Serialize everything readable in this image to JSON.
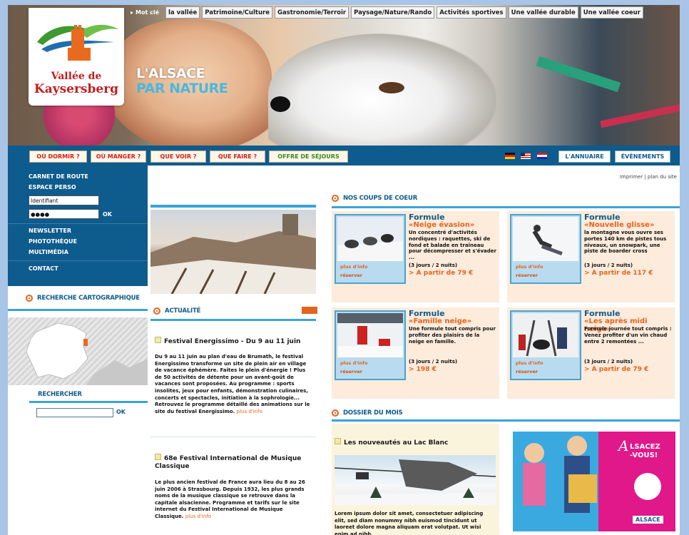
{
  "header": {
    "home_label": "Mot clé",
    "nav": [
      "la vallée",
      "Patrimoine/Culture",
      "Gastronomie/Terroir",
      "Paysage/Nature/Rando",
      "Activités sportives",
      "Une vallée durable",
      "Une vallée coeur"
    ],
    "logo_line1": "Vallée de",
    "logo_line2": "Kaysersberg",
    "tagline1": "L'ALSACE",
    "tagline2": "PAR NATURE"
  },
  "menu": {
    "items": [
      "OÙ DORMIR ?",
      "OÙ MANGER ?",
      "QUE VOIR ?",
      "QUE FAIRE ?",
      "OFFRE DE SÉJOURS"
    ],
    "right": [
      "L'ANNUAIRE",
      "ÉVÉNEMENTS"
    ]
  },
  "sidebar": {
    "links": [
      "CARNET DE ROUTE",
      "ESPACE PERSO"
    ],
    "login_value": "Identifiant",
    "password_value": "●●●●",
    "ok": "OK",
    "links2": [
      "NEWSLETTER",
      "PHOTOTHÈQUE",
      "MULTIMÉDIA"
    ],
    "contact": "CONTACT",
    "carto_title": "RECHERCHE CARTOGRAPHIQUE",
    "search_title": "RECHERCHER",
    "search_ok": "OK"
  },
  "middle": {
    "actualite": "ACTUALITÉ",
    "news": [
      {
        "title": "Festival Energissimo - Du 9 au 11 juin",
        "body": "Du 9 au 11 juin au plan d'eau de Brumath, le festival Energissimo transforme un site de plein air en village de vacance éphémère. Faites le plein d'énergie ! Plus de 50 activités de détente pour un avant-goût de vacances sont proposées. Au programme : sports insolites, jeux pour enfants, démonstration culinaires, concerts et spectacles, initiation à la sophrologie... Retrouvez le programme détaillé des animations sur le site du festival Energissimo.",
        "more": "plus d'info"
      },
      {
        "title": "68e Festival International de Musique Classique",
        "body": "Le plus ancien festival de France aura lieu du 8 au 26 juin 2006 à Strasbourg. Depuis 1932, les plus grands noms de la musique classique se retrouve dans la capitale alsacienne. Programme et tarifs sur le site internet du Festival International de Musique Classique.",
        "more": "plus d'info"
      }
    ]
  },
  "right": {
    "top_links": "Imprimer | plan du site",
    "coups_title": "NOS COUPS DE COEUR",
    "offers": [
      {
        "formule": "Formule",
        "name": "«Neige évasion»",
        "desc": "Un concentré d'activités nordiques : raquettes, ski de fond et balade en traîneau pour décompresser et s'évader ...",
        "duration": "(3 jours / 2 nuits)",
        "price": "> A partir de 79 €",
        "link1": "plus d'info",
        "link2": "réserver"
      },
      {
        "formule": "Formule",
        "name": "«Nouvelle glisse»",
        "desc": "la montagne vous ouvre ses portes 140 km de pistes tous niveaux, un snowpark, une piste de boarder cross",
        "duration": "(3 jours / 2 nuits)",
        "price": "> A partir de 117 €",
        "link1": "plus d'info",
        "link2": "réserver"
      },
      {
        "formule": "Formule",
        "name": "«Famille neige»",
        "desc": "Une formule tout compris pour profiter des plaisirs de la neige en famille.",
        "duration": "(3 jours / 2 nuits)",
        "price": "> 198 €",
        "link1": "plus d'info",
        "link2": "réserver"
      },
      {
        "formule": "Formule",
        "name": "«Les après midi neige»",
        "desc": "Formule journée tout compris : Venez profiter d'un vin chaud entre 2 remontées ...",
        "duration": "(3 jours / 2 nuits)",
        "price": "> A partir de 79 €",
        "link1": "plus d'info",
        "link2": "réserver"
      }
    ],
    "dossier_title": "DOSSIER DU MOIS",
    "dossier_sub": "Les nouveautés au Lac Blanc",
    "dossier_body": "Lorem ipsum dolor sit amet, consectetuer adipiscing elit, sed diam nonummy nibh euismod tincidunt ut laoreet dolore magna aliquam erat volutpat. Ut wisi enim ad nibh",
    "promo1": "A",
    "promo2": "LSACEZ",
    "promo3": "-VOUS!",
    "promo_brand": "ALSACE"
  }
}
